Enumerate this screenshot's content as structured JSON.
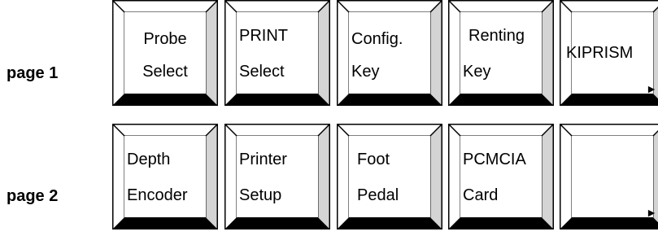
{
  "pages": [
    {
      "label": "page 1",
      "keys": [
        {
          "line1": "Probe",
          "line2": "Select",
          "align": "center"
        },
        {
          "line1": "PRINT",
          "line2": "Select",
          "align": "left"
        },
        {
          "line1": "Config.",
          "line2": "Key",
          "align": "left"
        },
        {
          "line1": "Renting",
          "line2": "Key",
          "align": "left"
        },
        {
          "line1": "KIPRISM",
          "line2": "",
          "arrow": "►"
        }
      ]
    },
    {
      "label": "page 2",
      "keys": [
        {
          "line1": "Depth",
          "line2": "Encoder",
          "align": "left"
        },
        {
          "line1": "Printer",
          "line2": "Setup",
          "align": "left"
        },
        {
          "line1": "Foot",
          "line2": "Pedal",
          "align": "left"
        },
        {
          "line1": "PCMCIA",
          "line2": "Card",
          "align": "left"
        },
        {
          "line1": "",
          "line2": "",
          "arrow": "►"
        }
      ]
    }
  ]
}
